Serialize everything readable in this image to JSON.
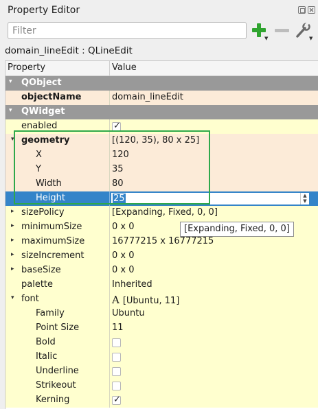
{
  "window": {
    "title": "Property Editor"
  },
  "filter": {
    "placeholder": "Filter",
    "value": ""
  },
  "object_label": "domain_lineEdit : QLineEdit",
  "columns": {
    "property": "Property",
    "value": "Value"
  },
  "groups": {
    "qobject": "QObject",
    "qwidget": "QWidget"
  },
  "rows": {
    "objectName": {
      "name": "objectName",
      "value": "domain_lineEdit"
    },
    "enabled": {
      "name": "enabled",
      "checked": true
    },
    "geometry": {
      "name": "geometry",
      "value": "[(120, 35), 80 x 25]"
    },
    "x": {
      "name": "X",
      "value": "120"
    },
    "y": {
      "name": "Y",
      "value": "35"
    },
    "width": {
      "name": "Width",
      "value": "80"
    },
    "height": {
      "name": "Height",
      "value": "25"
    },
    "sizePolicy": {
      "name": "sizePolicy",
      "value": "[Expanding, Fixed, 0, 0]"
    },
    "minimumSize": {
      "name": "minimumSize",
      "value": "0 x 0"
    },
    "maximumSize": {
      "name": "maximumSize",
      "value": "16777215 x 16777215"
    },
    "sizeIncrement": {
      "name": "sizeIncrement",
      "value": "0 x 0"
    },
    "baseSize": {
      "name": "baseSize",
      "value": "0 x 0"
    },
    "palette": {
      "name": "palette",
      "value": "Inherited"
    },
    "font": {
      "name": "font",
      "value": "[Ubuntu, 11]"
    },
    "family": {
      "name": "Family",
      "value": "Ubuntu"
    },
    "pointSize": {
      "name": "Point Size",
      "value": "11"
    },
    "bold": {
      "name": "Bold",
      "checked": false
    },
    "italic": {
      "name": "Italic",
      "checked": false
    },
    "underline": {
      "name": "Underline",
      "checked": false
    },
    "strikeout": {
      "name": "Strikeout",
      "checked": false
    },
    "kerning": {
      "name": "Kerning",
      "checked": true
    }
  },
  "tooltip": "[Expanding, Fixed, 0, 0]",
  "colors": {
    "group": "#999999",
    "row": "#ffffcf",
    "selected": "#3484c9",
    "highlight": "#2ea84b",
    "add": "#2fa42f"
  }
}
